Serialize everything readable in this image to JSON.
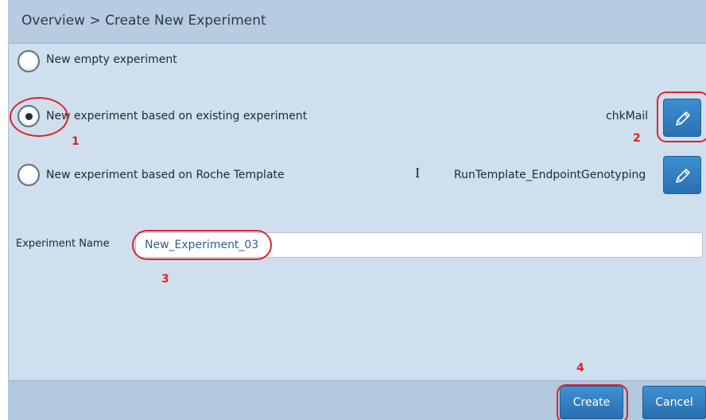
{
  "header": {
    "breadcrumb": "Overview > Create New Experiment"
  },
  "options": [
    {
      "label": "New empty experiment",
      "selected": false
    },
    {
      "label": "New experiment based on existing experiment",
      "selected": true,
      "source_name": "chkMail",
      "edit_icon": "pencil-icon"
    },
    {
      "label": "New experiment based on Roche Template",
      "selected": false,
      "source_name": "RunTemplate_EndpointGenotyping",
      "edit_icon": "pencil-icon"
    }
  ],
  "experiment_name": {
    "label": "Experiment Name",
    "value": "New_Experiment_03"
  },
  "footer": {
    "create_label": "Create",
    "cancel_label": "Cancel"
  },
  "annotations": {
    "markers": [
      "1",
      "2",
      "3",
      "4"
    ],
    "color": "#d8262e"
  },
  "colors": {
    "header_bg": "#b7cce0",
    "panel_bg": "#cfdfee",
    "footer_bg": "#b2c8dd",
    "button_blue": "#2f7cc0",
    "input_text": "#2d5f94"
  },
  "cursor": "text-cursor-icon"
}
